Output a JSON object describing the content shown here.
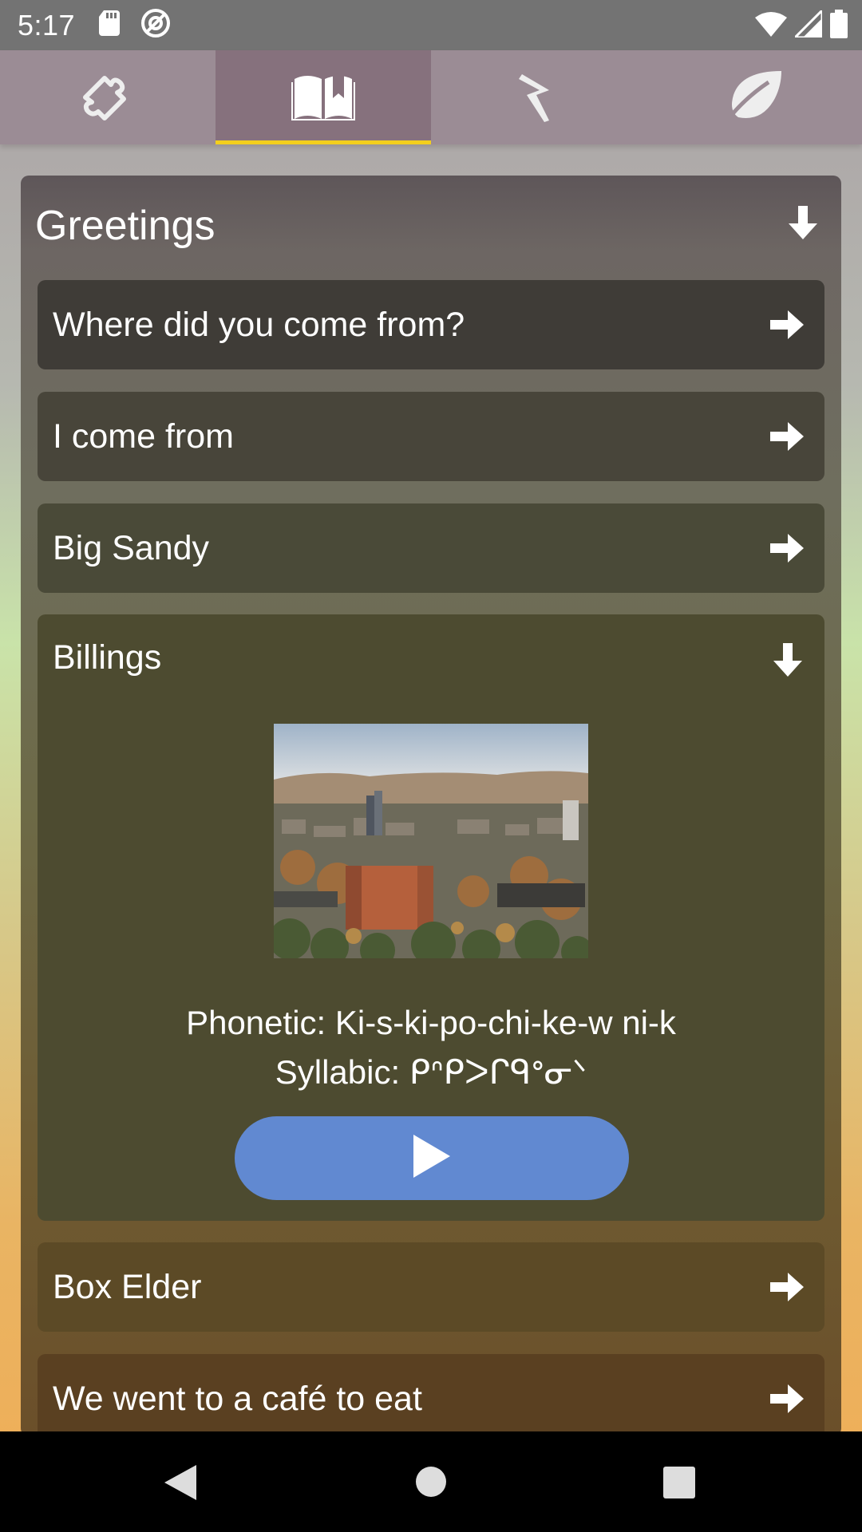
{
  "status": {
    "time": "5:17"
  },
  "tabs": [
    {
      "icon": "puzzle-icon",
      "active": false
    },
    {
      "icon": "book-icon",
      "active": true
    },
    {
      "icon": "lightning-icon",
      "active": false
    },
    {
      "icon": "leaf-icon",
      "active": false
    }
  ],
  "section": {
    "title": "Greetings",
    "items": [
      {
        "label": "Where did you come from?"
      },
      {
        "label": "I come from"
      },
      {
        "label": "Big Sandy"
      }
    ],
    "expanded": {
      "label": "Billings",
      "phonetic": "Phonetic: Ki-s-ki-po-chi-ke-w  ni-k",
      "syllabic": "Syllabic: ᑭᐢᑭᐳᒋᑫᐤᓂᐠ"
    },
    "items_after": [
      {
        "label": "Box Elder"
      },
      {
        "label": "We went to a café to eat"
      }
    ]
  },
  "colors": {
    "accent_underline": "#f3cf1c",
    "play_button": "#6189d1"
  }
}
